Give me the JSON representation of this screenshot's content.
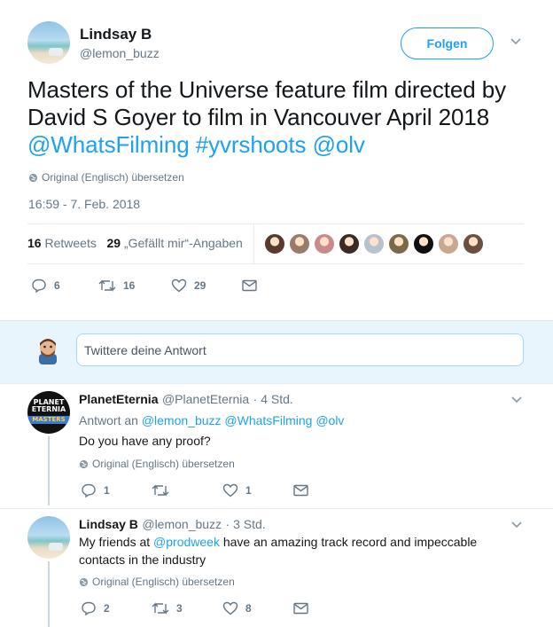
{
  "tweet": {
    "author_name": "Lindsay B",
    "author_handle": "@lemon_buzz",
    "follow_label": "Folgen",
    "text_plain": "Masters of the Universe feature film directed by David S Goyer to film in Vancouver April 2018 ",
    "text_links": [
      "@WhatsFilming",
      "#yvrshoots",
      "@olv"
    ],
    "translate_label": "Original (Englisch) übersetzen",
    "timestamp": "16:59 - 7. Feb. 2018",
    "retweets_count": "16",
    "retweets_label": "Retweets",
    "likes_count": "29",
    "likes_label": "„Gefällt mir“-Angaben",
    "liker_avatars": [
      "#5b3a2e",
      "#9a7a6a",
      "#c98a8a",
      "#3b2b24",
      "#b8c2cc",
      "#7b6a4a",
      "#101010",
      "#c8a890",
      "#6b5040"
    ],
    "actions": {
      "replies": "6",
      "retweets": "16",
      "likes": "29"
    }
  },
  "composer": {
    "placeholder": "Twittere deine Antwort"
  },
  "replies": [
    {
      "name": "PlanetEternia",
      "handle": "@PlanetEternia",
      "time": "· 4 Std.",
      "reply_to_label": "Antwort an",
      "reply_to": [
        "@lemon_buzz",
        "@WhatsFilming",
        "@olv"
      ],
      "text": "Do you have any proof?",
      "translate_label": "Original (Englisch) übersetzen",
      "actions": {
        "replies": "1",
        "retweets": "",
        "likes": "1"
      },
      "logo_lines": [
        "PLANET",
        "ETERNIA",
        "MASTERS"
      ]
    },
    {
      "name": "Lindsay B",
      "handle": "@lemon_buzz",
      "time": "· 3 Std.",
      "text_before": "My friends at ",
      "text_link": "@prodweek",
      "text_after": " have an amazing track record and impeccable contacts in the industry",
      "translate_label": "Original (Englisch) übersetzen",
      "actions": {
        "replies": "2",
        "retweets": "3",
        "likes": "8"
      }
    }
  ]
}
